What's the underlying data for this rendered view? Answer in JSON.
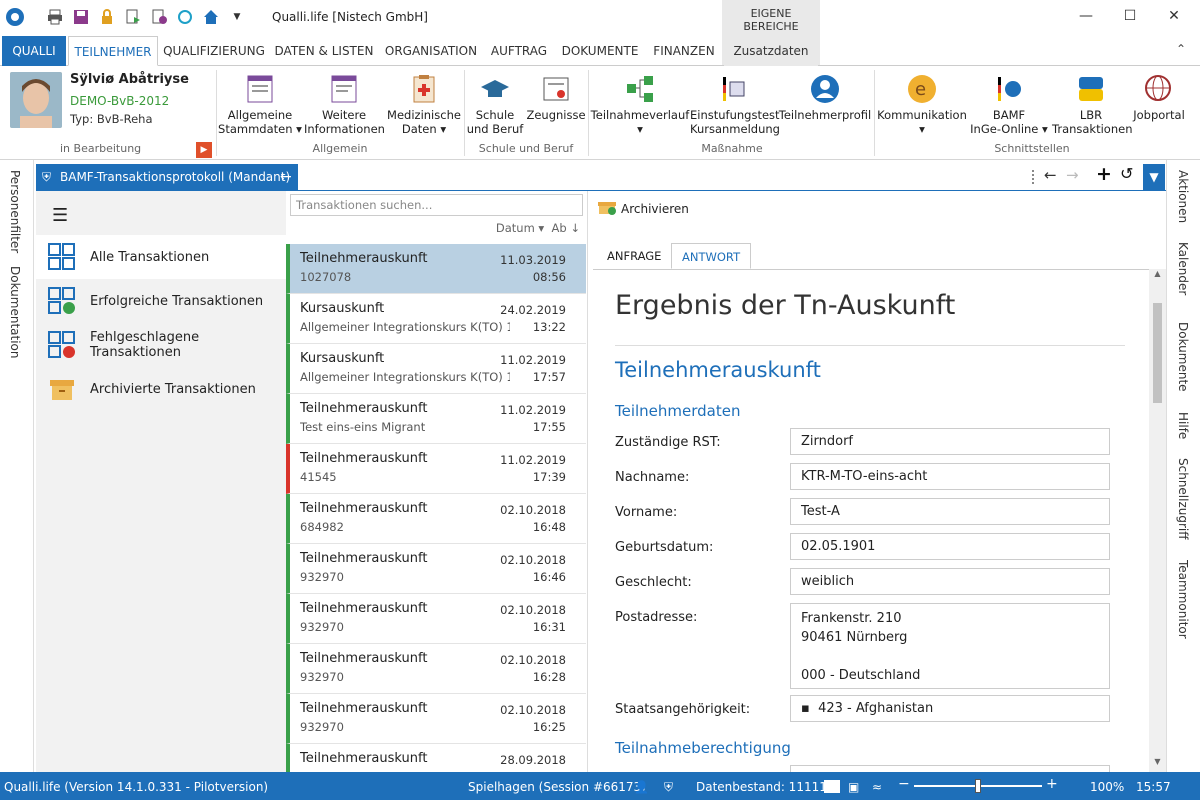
{
  "app": {
    "title": "Qualli.life [Nistech GmbH]"
  },
  "ribbon_tabs": [
    {
      "label": "QUALLI"
    },
    {
      "label": "TEILNEHMER"
    },
    {
      "label": "QUALIFIZIERUNG"
    },
    {
      "label": "DATEN & LISTEN"
    },
    {
      "label": "ORGANISATION"
    },
    {
      "label": "AUFTRAG"
    },
    {
      "label": "DOKUMENTE"
    },
    {
      "label": "FINANZEN"
    },
    {
      "label": "Zusatzdaten"
    }
  ],
  "context_tab_header": "EIGENE BEREICHE",
  "participant": {
    "name": "Sÿlviø Abåtriyse",
    "program": "DEMO-BvB-2012",
    "type": "Typ: BvB-Reha",
    "status": "in Bearbeitung"
  },
  "ribbon": {
    "btn_allgemeine_1": "Allgemeine",
    "btn_allgemeine_2": "Stammdaten",
    "btn_weitere_1": "Weitere",
    "btn_weitere_2": "Informationen",
    "btn_med_1": "Medizinische",
    "btn_med_2": "Daten",
    "group_allgemein": "Allgemein",
    "btn_schule_1": "Schule",
    "btn_schule_2": "und Beruf",
    "btn_zeugnisse": "Zeugnisse",
    "group_schule": "Schule und Beruf",
    "btn_tnverlauf": "Teilnahmeverlauf",
    "btn_einst_1": "Einstufungstest",
    "btn_einst_2": "Kursanmeldung",
    "btn_tnprofil": "Teilnehmerprofil",
    "group_massnahme": "Maßnahme",
    "btn_komm": "Kommunikation",
    "btn_bamf_1": "BAMF",
    "btn_bamf_2": "InGe-Online",
    "btn_lbr_1": "LBR",
    "btn_lbr_2": "Transaktionen",
    "btn_jobportal": "Jobportal",
    "group_schnitt": "Schnittstellen"
  },
  "left_sidebar": [
    "Personenfilter",
    "Dokumentation"
  ],
  "right_sidebar": [
    "Aktionen",
    "Kalender",
    "Dokumente",
    "Hilfe",
    "Schnellzugriff",
    "Teammonitor"
  ],
  "doc_tab": {
    "title": "BAMF-Transaktionsprotokoll (Mandant)"
  },
  "nav": {
    "items": [
      {
        "label": "Alle Transaktionen"
      },
      {
        "label": "Erfolgreiche Transaktionen"
      },
      {
        "label": "Fehlgeschlagene Transaktionen"
      },
      {
        "label": "Archivierte Transaktionen"
      }
    ]
  },
  "list": {
    "search_placeholder": "Transaktionen suchen...",
    "sort_label": "Datum ▾",
    "sort_dir": "Ab ↓",
    "rows": [
      {
        "title": "Teilnehmerauskunft",
        "sub": "1027078",
        "date": "11.03.2019",
        "time": "08:56"
      },
      {
        "title": "Kursauskunft",
        "sub": "Allgemeiner Integrationskurs K(TO) 1...",
        "date": "24.02.2019",
        "time": "13:22"
      },
      {
        "title": "Kursauskunft",
        "sub": "Allgemeiner Integrationskurs K(TO) 1...",
        "date": "11.02.2019",
        "time": "17:57"
      },
      {
        "title": "Teilnehmerauskunft",
        "sub": "Test eins-eins Migrant",
        "date": "11.02.2019",
        "time": "17:55"
      },
      {
        "title": "Teilnehmerauskunft",
        "sub": "41545",
        "date": "11.02.2019",
        "time": "17:39"
      },
      {
        "title": "Teilnehmerauskunft",
        "sub": "684982",
        "date": "02.10.2018",
        "time": "16:48"
      },
      {
        "title": "Teilnehmerauskunft",
        "sub": "932970",
        "date": "02.10.2018",
        "time": "16:46"
      },
      {
        "title": "Teilnehmerauskunft",
        "sub": "932970",
        "date": "02.10.2018",
        "time": "16:31"
      },
      {
        "title": "Teilnehmerauskunft",
        "sub": "932970",
        "date": "02.10.2018",
        "time": "16:28"
      },
      {
        "title": "Teilnehmerauskunft",
        "sub": "932970",
        "date": "02.10.2018",
        "time": "16:25"
      },
      {
        "title": "Teilnehmerauskunft",
        "sub": "",
        "date": "28.09.2018",
        "time": ""
      }
    ]
  },
  "detail": {
    "archive_label": "Archivieren",
    "tab_anfrage": "ANFRAGE",
    "tab_antwort": "ANTWORT",
    "heading": "Ergebnis der Tn-Auskunft",
    "section": "Teilnehmerauskunft",
    "subsection": "Teilnehmerdaten",
    "fields": [
      {
        "label": "Zuständige RST:",
        "value": "Zirndorf"
      },
      {
        "label": "Nachname:",
        "value": "KTR-M-TO-eins-acht"
      },
      {
        "label": "Vorname:",
        "value": "Test-A"
      },
      {
        "label": "Geburtsdatum:",
        "value": "02.05.1901"
      },
      {
        "label": "Geschlecht:",
        "value": "weiblich"
      }
    ],
    "address_label": "Postadresse:",
    "address_lines": [
      "Frankenstr. 210",
      "90461 Nürnberg",
      "",
      "000 - Deutschland"
    ],
    "nationality_label": "Staatsangehörigkeit:",
    "nationality_value": "423 - Afghanistan",
    "next_section": "Teilnahmeberechtigung"
  },
  "status": {
    "version": "Qualli.life (Version 14.1.0.331 - Pilotversion)",
    "session": "Spielhagen (Session #66173)",
    "datenbestand": "Datenbestand: 11111",
    "zoom": "100%",
    "zoom_level": 0.5,
    "time": "15:57"
  },
  "colors": {
    "accent": "#1e6fb9",
    "success": "#3aa04a",
    "error": "#d9342b",
    "selected": "#b9d0e2"
  }
}
